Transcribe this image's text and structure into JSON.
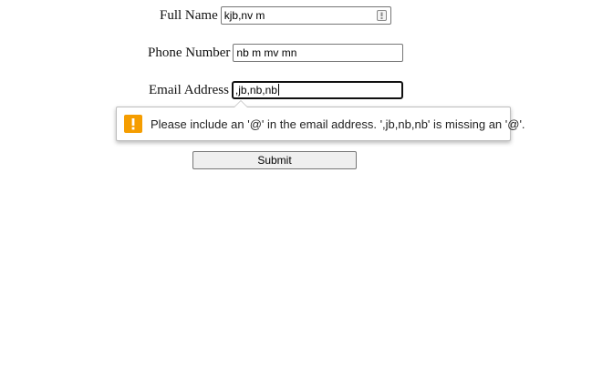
{
  "form": {
    "full_name": {
      "label": "Full Name",
      "value": "kjb,nv m"
    },
    "phone": {
      "label": "Phone Number",
      "value": "nb m mv mn"
    },
    "email": {
      "label": "Email Address",
      "value": ",jb,nb,nb"
    },
    "submit_label": "Submit"
  },
  "validation": {
    "message": "Please include an '@' in the email address. ',jb,nb,nb' is missing an '@'.",
    "icon": "warning-icon",
    "icon_color": "#f59d00"
  }
}
